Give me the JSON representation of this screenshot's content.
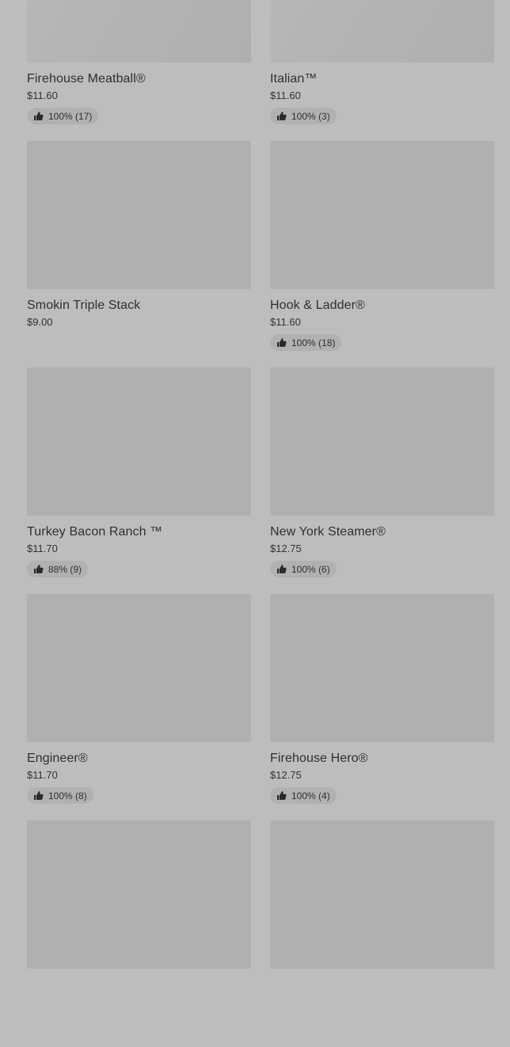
{
  "items": [
    {
      "name": "Firehouse Meatball®",
      "price": "$11.60",
      "rating": "100% (17)",
      "rated": true
    },
    {
      "name": "Italian™",
      "price": "$11.60",
      "rating": "100% (3)",
      "rated": true
    },
    {
      "name": "Smokin Triple Stack",
      "price": "$9.00",
      "rating": "",
      "rated": false
    },
    {
      "name": "Hook & Ladder®",
      "price": "$11.60",
      "rating": "100% (18)",
      "rated": true
    },
    {
      "name": "Turkey Bacon Ranch ™",
      "price": "$11.70",
      "rating": "88% (9)",
      "rated": true
    },
    {
      "name": "New York Steamer®",
      "price": "$12.75",
      "rating": "100% (6)",
      "rated": true
    },
    {
      "name": "Engineer®",
      "price": "$11.70",
      "rating": "100% (8)",
      "rated": true
    },
    {
      "name": "Firehouse Hero®",
      "price": "$12.75",
      "rating": "100% (4)",
      "rated": true
    },
    {
      "name": "",
      "price": "",
      "rating": "",
      "rated": false
    },
    {
      "name": "",
      "price": "",
      "rating": "",
      "rated": false
    }
  ],
  "icons": {
    "rating": "thumbs-up-icon"
  },
  "colors": {
    "background": "#bdbdbd",
    "image_placeholder": "#b0b0b0",
    "rating_pill": "#b1b1b1",
    "text": "#2f2f2f"
  }
}
